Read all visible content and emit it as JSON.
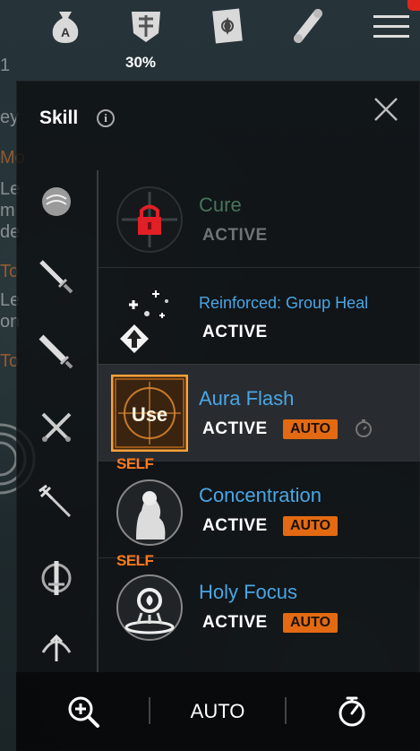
{
  "topbar": {
    "icons": [
      "money-bag-icon",
      "guild-crest-icon",
      "card-book-icon",
      "scroll-icon",
      "hamburger-menu-icon"
    ],
    "left_count": "1",
    "crest_value": "30%"
  },
  "panel": {
    "title": "Skill",
    "info_icon": "i"
  },
  "categories": [
    "round-shield-icon",
    "dagger-icon",
    "sword-icon",
    "crossed-swords-icon",
    "trident-icon",
    "greatsword-icon",
    "bow-icon"
  ],
  "skills": [
    {
      "name": "Cure",
      "status": "ACTIVE",
      "locked": true,
      "auto": "",
      "self": ""
    },
    {
      "name": "Reinforced: Group Heal",
      "status": "ACTIVE",
      "locked": false,
      "auto": "",
      "self": ""
    },
    {
      "name": "Aura Flash",
      "status": "ACTIVE",
      "locked": false,
      "auto": "AUTO",
      "self": "",
      "use_label": "Use",
      "selected": true
    },
    {
      "name": "Concentration",
      "status": "ACTIVE",
      "locked": false,
      "auto": "AUTO",
      "self": "SELF"
    },
    {
      "name": "Holy Focus",
      "status": "ACTIVE",
      "locked": false,
      "auto": "AUTO",
      "self": "SELF"
    }
  ],
  "footer": {
    "zoom_icon": "magnifier-plus-icon",
    "auto_label": "AUTO",
    "timer_icon": "stopwatch-icon"
  },
  "background_text": [
    "ey",
    "Le",
    "m",
    "de",
    "Le",
    "on",
    "Mo",
    "To",
    "To"
  ],
  "colors": {
    "skill_name": "#4aa6e6",
    "locked_name": "#48745a",
    "auto_badge": "#e36a12",
    "self_tag": "#ff7a1a",
    "panel_bg": "#0e1012"
  }
}
